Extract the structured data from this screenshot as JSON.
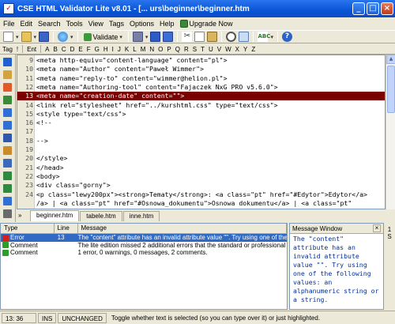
{
  "window": {
    "title": "CSE HTML Validator Lite v8.01 - [... urs\\beginner\\beginner.htm"
  },
  "menu": {
    "items": [
      "File",
      "Edit",
      "Search",
      "Tools",
      "View",
      "Tags",
      "Options",
      "Help"
    ],
    "upgrade_label": "Upgrade Now"
  },
  "toolbar": {
    "validate_label": "Validate",
    "icons": [
      "new-document-icon",
      "open-folder-icon",
      "save-icon",
      "web-icon",
      "validate-icon",
      "config-icon",
      "save-all-icon",
      "properties-icon",
      "cut-icon",
      "copy-icon",
      "paste-icon",
      "find-icon",
      "replace-icon",
      "spellcheck-icon",
      "help-icon"
    ]
  },
  "tagbar": {
    "items": [
      "Tag",
      "!",
      "Ent",
      "A",
      "B",
      "C",
      "D",
      "E",
      "F",
      "G",
      "H",
      "I",
      "J",
      "K",
      "L",
      "M",
      "N",
      "O",
      "P",
      "Q",
      "R",
      "S",
      "T",
      "U",
      "V",
      "W",
      "X",
      "Y",
      "Z"
    ]
  },
  "editor": {
    "lines": [
      {
        "n": "9",
        "text": "<meta http-equiv=\"content-language\" content=\"pl\">"
      },
      {
        "n": "10",
        "text": "<meta name=\"Author\" content=\"Paweł Wimmer\">"
      },
      {
        "n": "11",
        "text": "<meta name=\"reply-to\" content=\"wimmer@helion.pl\">"
      },
      {
        "n": "12",
        "text": "<meta name=\"Authoring-tool\" content=\"Fajaczek NxG PRO v5.6.0\">"
      },
      {
        "n": "13",
        "text": "<meta name=\"creation-date\" content=\"\">"
      },
      {
        "n": "14",
        "text": "<link rel=\"stylesheet\" href=\"../kurshtml.css\" type=\"text/css\">"
      },
      {
        "n": "15",
        "text": "<style type=\"text/css\">"
      },
      {
        "n": "16",
        "text": "<!--"
      },
      {
        "n": "17",
        "text": ""
      },
      {
        "n": "18",
        "text": "-->"
      },
      {
        "n": "19",
        "text": ""
      },
      {
        "n": "20",
        "text": "</style>"
      },
      {
        "n": "21",
        "text": "</head>"
      },
      {
        "n": "22",
        "text": "<body>"
      },
      {
        "n": "23",
        "text": "<div class=\"gorny\">"
      },
      {
        "n": "24",
        "text": "<p class=\"lewy200px\"><strong>Tematy</strong>: <a class=\"pt\" href=\"#Edytor\">Edytor</a>"
      },
      {
        "n": "",
        "text": "/a> | <a class=\"pt\" href=\"#Osnowa_dokumentu\">Osnowa dokumentu</a> | <a class=\"pt\""
      }
    ],
    "highlighted_line": "13"
  },
  "file_tabs": [
    "beginner.htm",
    "tabele.htm",
    "inne.htm"
  ],
  "messages": {
    "headers": [
      "Type",
      "Line",
      "Message"
    ],
    "rows": [
      {
        "type": "Error",
        "line": "13",
        "message": "The \"content\" attribute has an invalid attribute value \"\". Try using one of the following values: an alphanumeric string or a string.",
        "kind": "error"
      },
      {
        "type": "Comment",
        "line": "",
        "message": "The lite edition missed 2 additional errors that the standard or professional edition would have found.",
        "kind": "comment"
      },
      {
        "type": "Comment",
        "line": "",
        "message": "1 error, 0 warnings, 0 messages, 2 comments.",
        "kind": "comment"
      }
    ]
  },
  "message_window": {
    "title": "Message Window",
    "text": "The \"content\" attribute has an invalid attribute value \"\". Try using one of the following values: an alphanumeric string or a string.",
    "side_chars": [
      "1",
      "S"
    ]
  },
  "status": {
    "time": "13: 36",
    "mode": "INS",
    "state": "UNCHANGED",
    "hint": "Toggle whether text is selected (so you can type over it) or just highlighted."
  },
  "colors": {
    "highlight": "#7a0000",
    "selection": "#316ac5",
    "titlebar": "#0a55d8"
  }
}
